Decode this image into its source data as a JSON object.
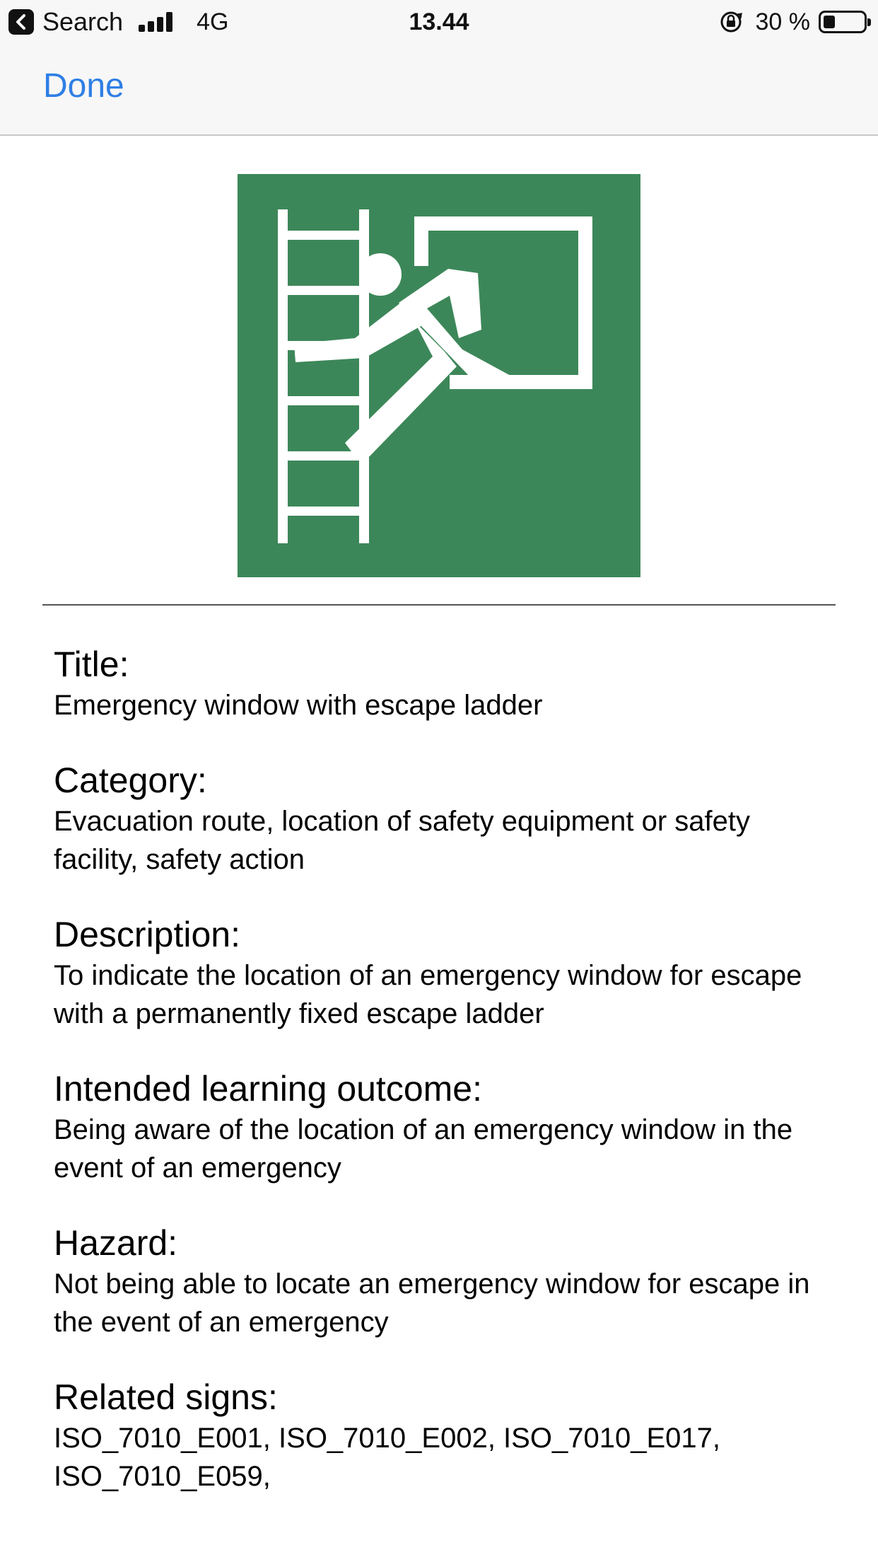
{
  "status_bar": {
    "back_app": "Search",
    "network": "4G",
    "time": "13.44",
    "battery_percent_text": "30 %",
    "battery_level": 0.3
  },
  "nav": {
    "done_label": "Done"
  },
  "sign": {
    "background_color": "#3c8759",
    "icon": "emergency-window-escape-ladder-icon"
  },
  "fields": {
    "title": {
      "label": "Title:",
      "value": "Emergency window with escape ladder"
    },
    "category": {
      "label": "Category:",
      "value": "Evacuation route, location of safety equipment or safety facility, safety action"
    },
    "description": {
      "label": "Description:",
      "value": "To indicate the location of an emergency window for escape with a permanently fixed escape ladder"
    },
    "learning_outcome": {
      "label": "Intended learning outcome:",
      "value": "Being aware of the location of an emergency window in the event of an emergency"
    },
    "hazard": {
      "label": "Hazard:",
      "value": "Not being able to locate an emergency window for escape in the event of an emergency"
    },
    "related_signs": {
      "label": "Related signs:",
      "value": "ISO_7010_E001, ISO_7010_E002, ISO_7010_E017, ISO_7010_E059,"
    }
  },
  "colors": {
    "accent": "#2f7fe5",
    "bar_background": "#f7f7f7"
  }
}
